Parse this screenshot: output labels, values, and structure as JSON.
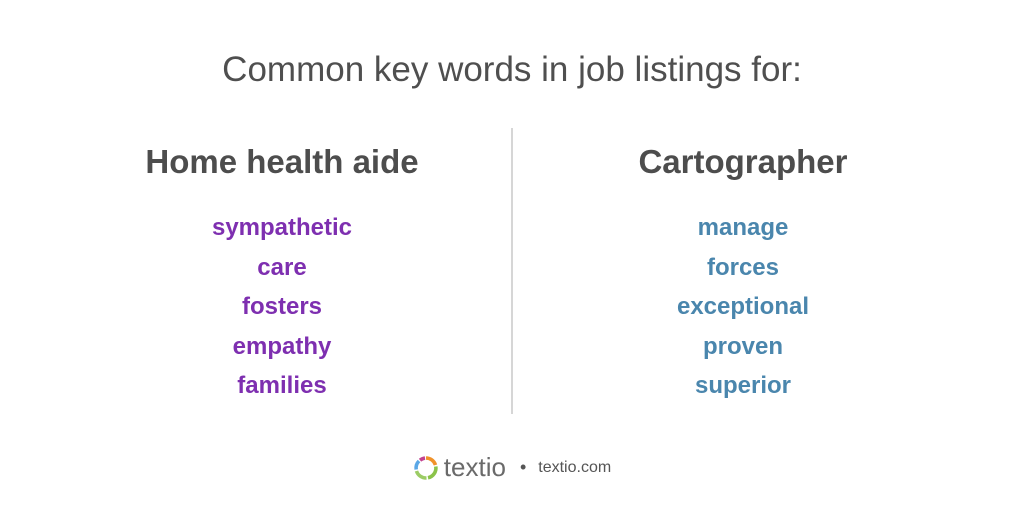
{
  "title": "Common key words in job listings for:",
  "columns": [
    {
      "heading": "Home health aide",
      "words": [
        "sympathetic",
        "care",
        "fosters",
        "empathy",
        "families"
      ],
      "color": "#7e2fb0"
    },
    {
      "heading": "Cartographer",
      "words": [
        "manage",
        "forces",
        "exceptional",
        "proven",
        "superior"
      ],
      "color": "#4a86ad"
    }
  ],
  "footer": {
    "logo_icon": "textio-ring-logo-icon",
    "brand": "textio",
    "separator": "•",
    "site": "textio.com"
  }
}
